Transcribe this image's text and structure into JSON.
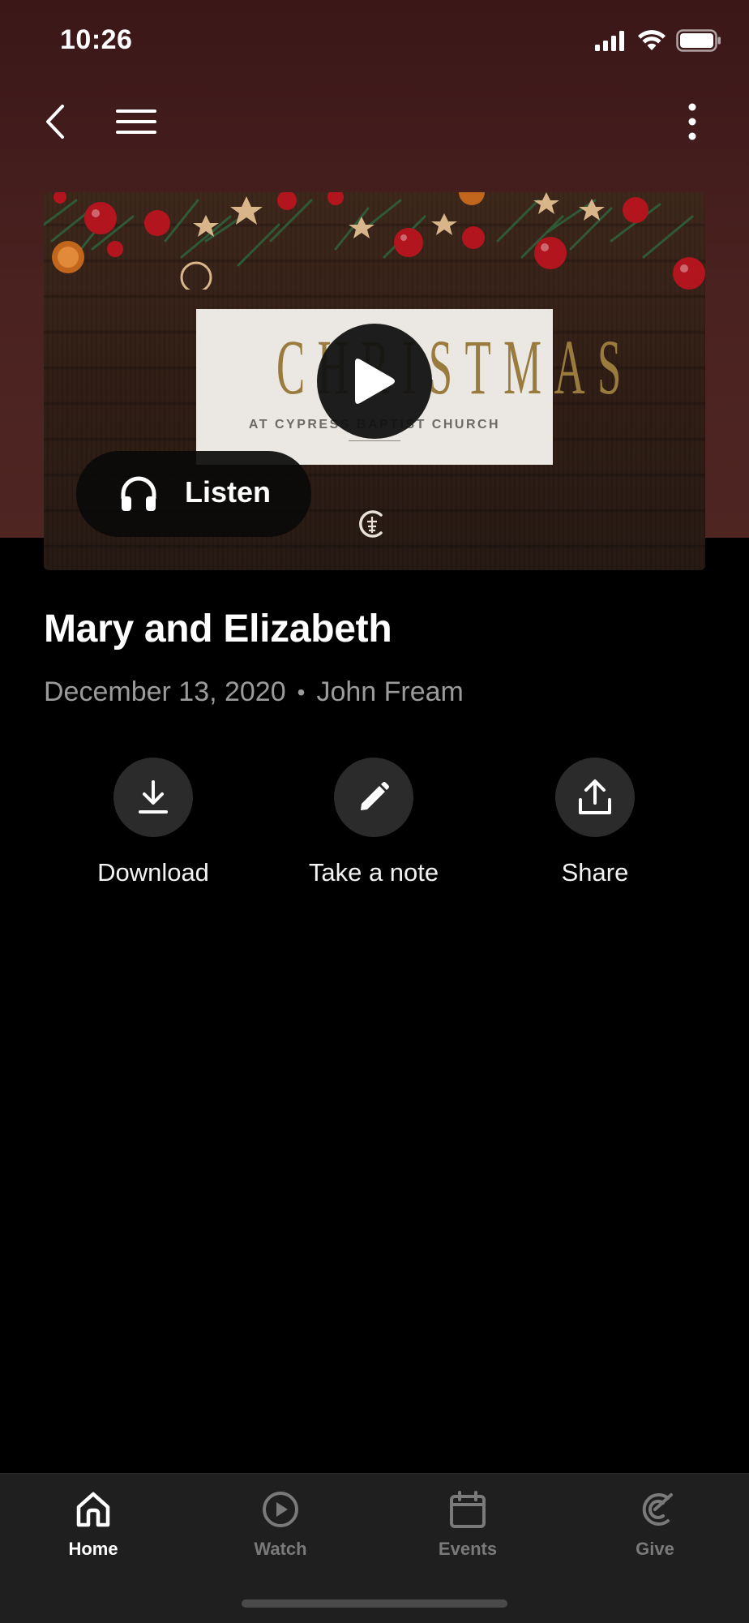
{
  "status_bar": {
    "time": "10:26"
  },
  "nav": {
    "back_icon": "chevron-left-icon",
    "menu_icon": "hamburger-menu-icon",
    "more_icon": "vertical-ellipsis-icon"
  },
  "hero": {
    "card_title": "CHRISTMAS",
    "card_subtitle": "AT CYPRESS BAPTIST CHURCH",
    "play_icon": "play-icon",
    "listen_label": "Listen",
    "listen_icon": "headphones-icon"
  },
  "sermon": {
    "title": "Mary and Elizabeth",
    "date": "December 13, 2020",
    "separator": "•",
    "speaker": "John Fream"
  },
  "actions": [
    {
      "label": "Download",
      "icon": "download-icon"
    },
    {
      "label": "Take a note",
      "icon": "pencil-icon"
    },
    {
      "label": "Share",
      "icon": "share-icon"
    }
  ],
  "tabbar": {
    "tabs": [
      {
        "label": "Home",
        "icon": "home-icon",
        "active": true
      },
      {
        "label": "Watch",
        "icon": "play-circle-icon",
        "active": false
      },
      {
        "label": "Events",
        "icon": "calendar-icon",
        "active": false
      },
      {
        "label": "Give",
        "icon": "give-icon",
        "active": false
      }
    ]
  },
  "colors": {
    "header_bg": "#4a2220",
    "page_bg": "#000000",
    "tabbar_bg": "#1f1f1f",
    "action_circle": "#2b2b2b",
    "muted_text": "#9b9b9b",
    "card_gold": "#9a7b3e"
  }
}
